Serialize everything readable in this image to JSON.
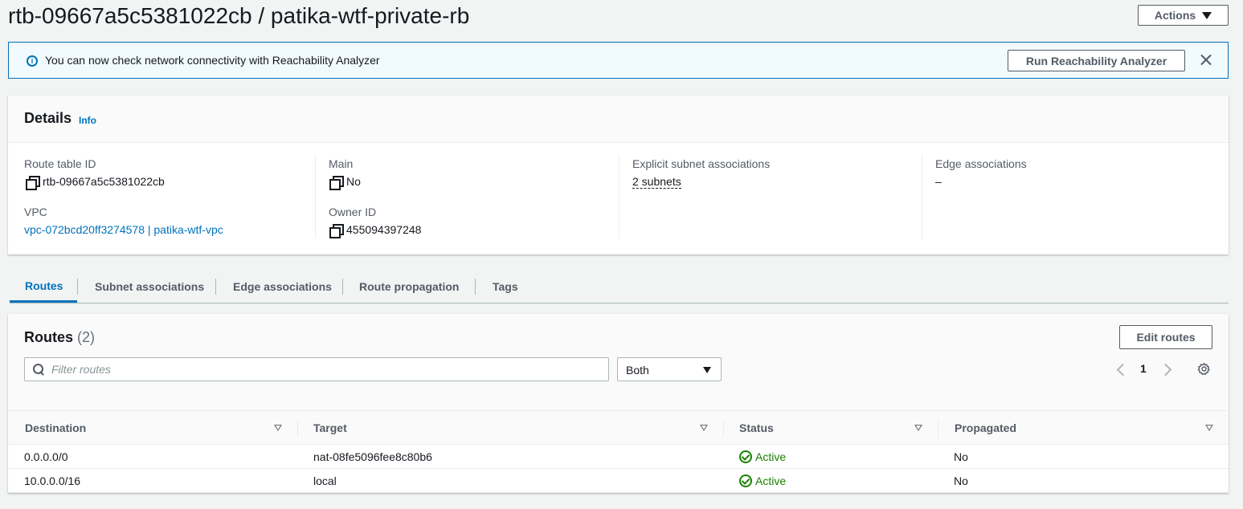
{
  "header": {
    "title": "rtb-09667a5c5381022cb / patika-wtf-private-rb",
    "actions_label": "Actions"
  },
  "banner": {
    "text": "You can now check network connectivity with Reachability Analyzer",
    "button_label": "Run Reachability Analyzer"
  },
  "details": {
    "title": "Details",
    "info_label": "Info",
    "route_table_id_label": "Route table ID",
    "route_table_id": "rtb-09667a5c5381022cb",
    "main_label": "Main",
    "main_value": "No",
    "explicit_label": "Explicit subnet associations",
    "explicit_value": "2 subnets",
    "edge_label": "Edge associations",
    "edge_value": "–",
    "vpc_label": "VPC",
    "vpc_value": "vpc-072bcd20ff3274578 | patika-wtf-vpc",
    "owner_label": "Owner ID",
    "owner_value": "455094397248"
  },
  "tabs": [
    {
      "label": "Routes",
      "active": true
    },
    {
      "label": "Subnet associations",
      "active": false
    },
    {
      "label": "Edge associations",
      "active": false
    },
    {
      "label": "Route propagation",
      "active": false
    },
    {
      "label": "Tags",
      "active": false
    }
  ],
  "routes": {
    "title": "Routes",
    "count": "(2)",
    "edit_label": "Edit routes",
    "filter_placeholder": "Filter routes",
    "select_value": "Both",
    "page": "1",
    "columns": [
      "Destination",
      "Target",
      "Status",
      "Propagated"
    ],
    "rows": [
      {
        "destination": "0.0.0.0/0",
        "target": "nat-08fe5096fee8c80b6",
        "status": "Active",
        "propagated": "No"
      },
      {
        "destination": "10.0.0.0/16",
        "target": "local",
        "status": "Active",
        "propagated": "No"
      }
    ]
  },
  "colors": {
    "link": "#0073bb",
    "success": "#1d8102",
    "background": "#f2f3f3",
    "banner_bg": "#f1faff"
  }
}
